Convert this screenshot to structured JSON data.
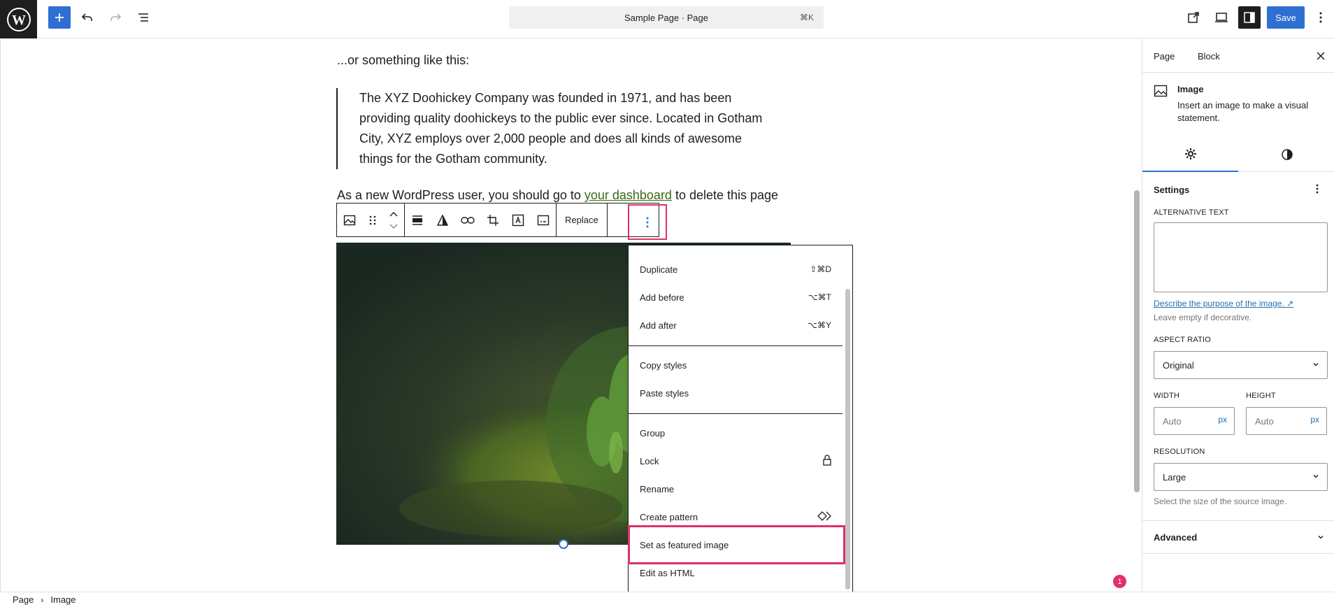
{
  "topbar": {
    "doc_title": "Sample Page · Page",
    "doc_shortcut": "⌘K",
    "save_label": "Save"
  },
  "content": {
    "intro": "...or something like this:",
    "quote": "The XYZ Doohickey Company was founded in 1971, and has been providing quality doohickeys to the public ever since. Located in Gotham City, XYZ employs over 2,000 people and does all kinds of awesome things for the Gotham community.",
    "para_before_link": "As a new WordPress user, you should go to ",
    "link_text": "your dashboard",
    "para_after_link": " to delete this page"
  },
  "block_toolbar": {
    "replace_label": "Replace"
  },
  "menu": {
    "items": [
      {
        "label": "Duplicate",
        "shortcut": "⇧⌘D"
      },
      {
        "label": "Add before",
        "shortcut": "⌥⌘T"
      },
      {
        "label": "Add after",
        "shortcut": "⌥⌘Y"
      },
      {
        "label": "Copy styles",
        "shortcut": ""
      },
      {
        "label": "Paste styles",
        "shortcut": ""
      },
      {
        "label": "Group",
        "shortcut": ""
      },
      {
        "label": "Lock",
        "shortcut": ""
      },
      {
        "label": "Rename",
        "shortcut": ""
      },
      {
        "label": "Create pattern",
        "shortcut": ""
      },
      {
        "label": "Set as featured image",
        "shortcut": ""
      },
      {
        "label": "Edit as HTML",
        "shortcut": ""
      }
    ]
  },
  "notification_count": "1",
  "breadcrumb": {
    "items": [
      "Page",
      "Image"
    ]
  },
  "sidebar": {
    "tabs": [
      "Page",
      "Block"
    ],
    "active_tab": "Block",
    "block": {
      "title": "Image",
      "description": "Insert an image to make a visual statement."
    },
    "settings_title": "Settings",
    "alt_text_label": "ALTERNATIVE TEXT",
    "alt_help_link": "Describe the purpose of the image.",
    "alt_help_text": "Leave empty if decorative.",
    "aspect_ratio_label": "ASPECT RATIO",
    "aspect_ratio_value": "Original",
    "width_label": "WIDTH",
    "width_placeholder": "Auto",
    "height_label": "HEIGHT",
    "height_placeholder": "Auto",
    "unit": "px",
    "resolution_label": "RESOLUTION",
    "resolution_value": "Large",
    "resolution_help": "Select the size of the source image.",
    "advanced_label": "Advanced"
  },
  "colors": {
    "accent": "#2f6fd1",
    "highlight": "#e0306b",
    "link": "#3a6a18"
  }
}
